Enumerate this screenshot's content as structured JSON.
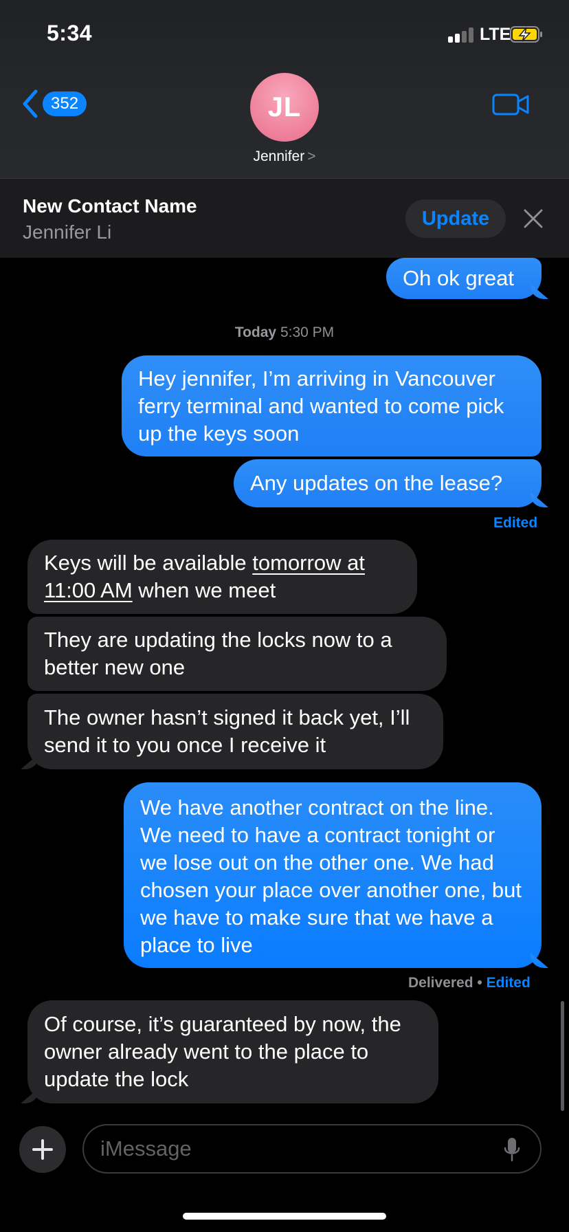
{
  "status_bar": {
    "time": "5:34",
    "network": "LTE"
  },
  "nav": {
    "back_count": "352",
    "avatar_initials": "JL",
    "contact_name": "Jennifer",
    "contact_chevron": ">"
  },
  "banner": {
    "title": "New Contact Name",
    "subtitle": "Jennifer Li",
    "update_label": "Update"
  },
  "conversation": {
    "timestamp_day": "Today",
    "timestamp_time": "5:30 PM",
    "messages": [
      {
        "from": "me",
        "text": "Oh ok great"
      },
      {
        "from": "me",
        "text": "Hey jennifer, I’m arriving in Vancouver ferry terminal and wanted to come pick up the keys soon"
      },
      {
        "from": "me",
        "text": "Any updates on the lease?"
      },
      {
        "from": "them",
        "text_before": "Keys will be available ",
        "text_link": "tomorrow at 11:00 AM",
        "text_after": " when we meet"
      },
      {
        "from": "them",
        "text": "They are updating the locks now to a better new one"
      },
      {
        "from": "them",
        "text": "The owner hasn’t signed it back yet, I’ll send it to you once I receive it"
      },
      {
        "from": "me",
        "text": "We have another contract on the line. We need to have a contract tonight or we lose out on the other one. We had chosen your place over another one, but we have to make sure that we have a place to live"
      },
      {
        "from": "them",
        "text": "Of course, it’s guaranteed by now, the owner already went to the place to update the lock"
      }
    ],
    "edited_label_1": "Edited",
    "delivered_label": "Delivered",
    "separator": "•",
    "edited_label_2": "Edited"
  },
  "composer": {
    "placeholder": "iMessage"
  },
  "colors": {
    "accent": "#0a84ff",
    "sent_bubble": "#1f7ff5",
    "received_bubble": "#262628",
    "avatar": "#ee7e9a"
  },
  "icons": [
    "back-chevron-icon",
    "video-camera-icon",
    "close-icon",
    "plus-icon",
    "microphone-icon",
    "battery-charging-icon",
    "signal-icon"
  ]
}
